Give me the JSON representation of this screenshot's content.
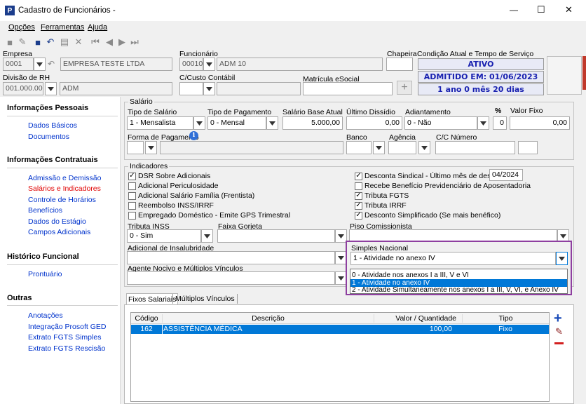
{
  "window": {
    "title": "Cadastro de Funcionários -",
    "minimize": "—",
    "maximize": "☐",
    "close": "✕"
  },
  "menu": [
    "Opções",
    "Ferramentas",
    "Ajuda"
  ],
  "header": {
    "empresa_label": "Empresa",
    "empresa_code": "0001",
    "empresa_name": "EMPRESA TESTE LTDA",
    "funcionario_label": "Funcionário",
    "funcionario_code": "00010",
    "funcionario_name": "ADM 10",
    "chapeira_label": "Chapeira",
    "condicao_label": "Condição Atual e Tempo de Serviço",
    "status": "ATIVO",
    "admissao": "ADMITIDO EM: 01/06/2023",
    "tempo": "1 ano 0 mês 20 dias",
    "divisao_label": "Divisão de RH",
    "divisao_code": "001.000.000",
    "divisao_name": "ADM",
    "custo_label": "C/Custo Contábil",
    "matricula_label": "Matrícula eSocial",
    "add_symbol": "+"
  },
  "sidebar": {
    "sections": [
      {
        "title": "Informações Pessoais",
        "items": [
          "Dados Básicos",
          "Documentos"
        ]
      },
      {
        "title": "Informações Contratuais",
        "items": [
          "Admissão e Demissão",
          "Salários e Indicadores",
          "Controle de Horários",
          "Benefícios",
          "Dados do Estágio",
          "Campos Adicionais"
        ]
      },
      {
        "title": "Histórico Funcional",
        "items": [
          "Prontuário"
        ]
      },
      {
        "title": "Outras",
        "items": [
          "Anotações",
          "Integração Prosoft GED",
          "Extrato FGTS Simples",
          "Extrato FGTS Rescisão"
        ]
      }
    ]
  },
  "salario": {
    "group_title": "Salário",
    "tipo_label": "Tipo de Salário",
    "tipo_value": "1 - Mensalista",
    "pagamento_label": "Tipo de Pagamento",
    "pagamento_value": "0 - Mensal",
    "base_label": "Salário Base Atual",
    "base_value": "5.000,00",
    "dissidio_label": "Último Dissídio",
    "dissidio_value": "0,00",
    "adiant_label": "Adiantamento",
    "adiant_value": "0 - Não",
    "pct_label": "%",
    "pct_value": "0",
    "fixo_label": "Valor Fixo",
    "fixo_value": "0,00",
    "forma_label": "Forma de Pagamento",
    "info_icon": "i",
    "banco_label": "Banco",
    "agencia_label": "Agência",
    "cc_label": "C/C Número"
  },
  "indicadores": {
    "group_title": "Indicadores",
    "left": [
      {
        "label": "DSR Sobre Adicionais",
        "checked": true
      },
      {
        "label": "Adicional Periculosidade",
        "checked": false
      },
      {
        "label": "Adicional Salário Família (Frentista)",
        "checked": false
      },
      {
        "label": "Reembolso INSS/IRRF",
        "checked": false
      },
      {
        "label": "Empregado Doméstico - Emite GPS Trimestral",
        "checked": false
      }
    ],
    "right": [
      {
        "label": "Desconta Sindical - Último mês de desconto",
        "checked": true
      },
      {
        "label": "Recebe Benefício Previdenciário de Aposentadoria",
        "checked": false
      },
      {
        "label": "Tributa FGTS",
        "checked": true
      },
      {
        "label": "Tributa IRRF",
        "checked": true
      },
      {
        "label": "Desconto Simplificado (Se mais benéfico)",
        "checked": true
      }
    ],
    "sindical_date": "04/2024",
    "inss_label": "Tributa INSS",
    "inss_value": "0 - Sim",
    "gorjeta_label": "Faixa Gorjeta",
    "piso_label": "Piso Comissionista",
    "insalub_label": "Adicional de Insalubridade",
    "simples_label": "Simples Nacional",
    "simples_value": "1 - Atividade no anexo IV",
    "simples_options": [
      "0 - Atividade nos anexos I a III, V e VI",
      "1 - Atividade no anexo IV",
      "2 - Atividade Simultaneamente nos anexos I a III, V, VI, e Anexo IV"
    ],
    "agente_label": "Agente Nocivo e  Múltiplos Vínculos"
  },
  "tabs": [
    "Fixos Salariais",
    "Múltiplos Vínculos"
  ],
  "table": {
    "headers": [
      "Código",
      "Descrição",
      "Valor / Quantidade",
      "Tipo"
    ],
    "rows": [
      {
        "codigo": "162",
        "descricao": "ASSISTÊNCIA MÉDICA",
        "valor": "100,00",
        "tipo": "Fixo"
      }
    ]
  },
  "colors": {
    "accent": "#0078d7",
    "status_text": "#1a22b0",
    "highlight_border": "#8e3fa0",
    "nav_link": "#0033cc",
    "nav_active": "#e00000",
    "row_selected": "#0078d7"
  },
  "icons": [
    "app-logo-icon",
    "new-icon",
    "edit-icon",
    "save-icon",
    "undo-icon",
    "print-icon",
    "delete-icon",
    "first-icon",
    "prev-icon",
    "next-icon",
    "last-icon",
    "info-icon",
    "add-icon",
    "edit-pencil-icon",
    "remove-icon"
  ]
}
